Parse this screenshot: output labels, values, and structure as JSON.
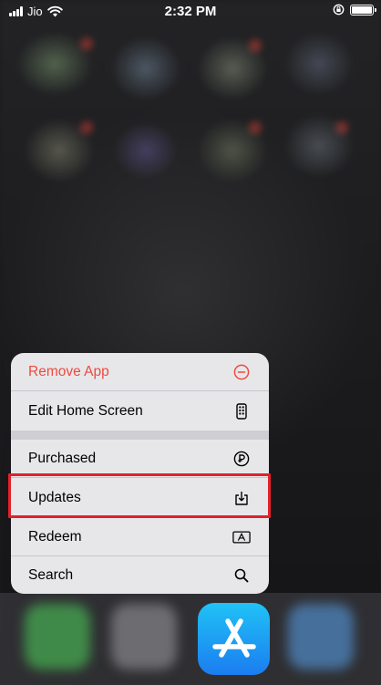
{
  "status_bar": {
    "carrier": "Jio",
    "time": "2:32 PM",
    "signal_bars": 4
  },
  "menu": {
    "items": [
      {
        "label": "Remove App",
        "icon": "minus-circle-icon",
        "destructive": true
      },
      {
        "label": "Edit Home Screen",
        "icon": "phone-screen-icon"
      },
      {
        "label": "Purchased",
        "icon": "purchased-p-icon"
      },
      {
        "label": "Updates",
        "icon": "download-tray-icon",
        "highlighted": true
      },
      {
        "label": "Redeem",
        "icon": "gift-card-icon"
      },
      {
        "label": "Search",
        "icon": "search-icon"
      }
    ]
  },
  "app": {
    "name_icon": "app-store-icon"
  },
  "colors": {
    "destructive": "#ef4a3f",
    "highlight_box": "#e2202a",
    "menu_bg": "#e7e7e9",
    "appstore_top": "#20c2f6",
    "appstore_bottom": "#1b7df0"
  }
}
